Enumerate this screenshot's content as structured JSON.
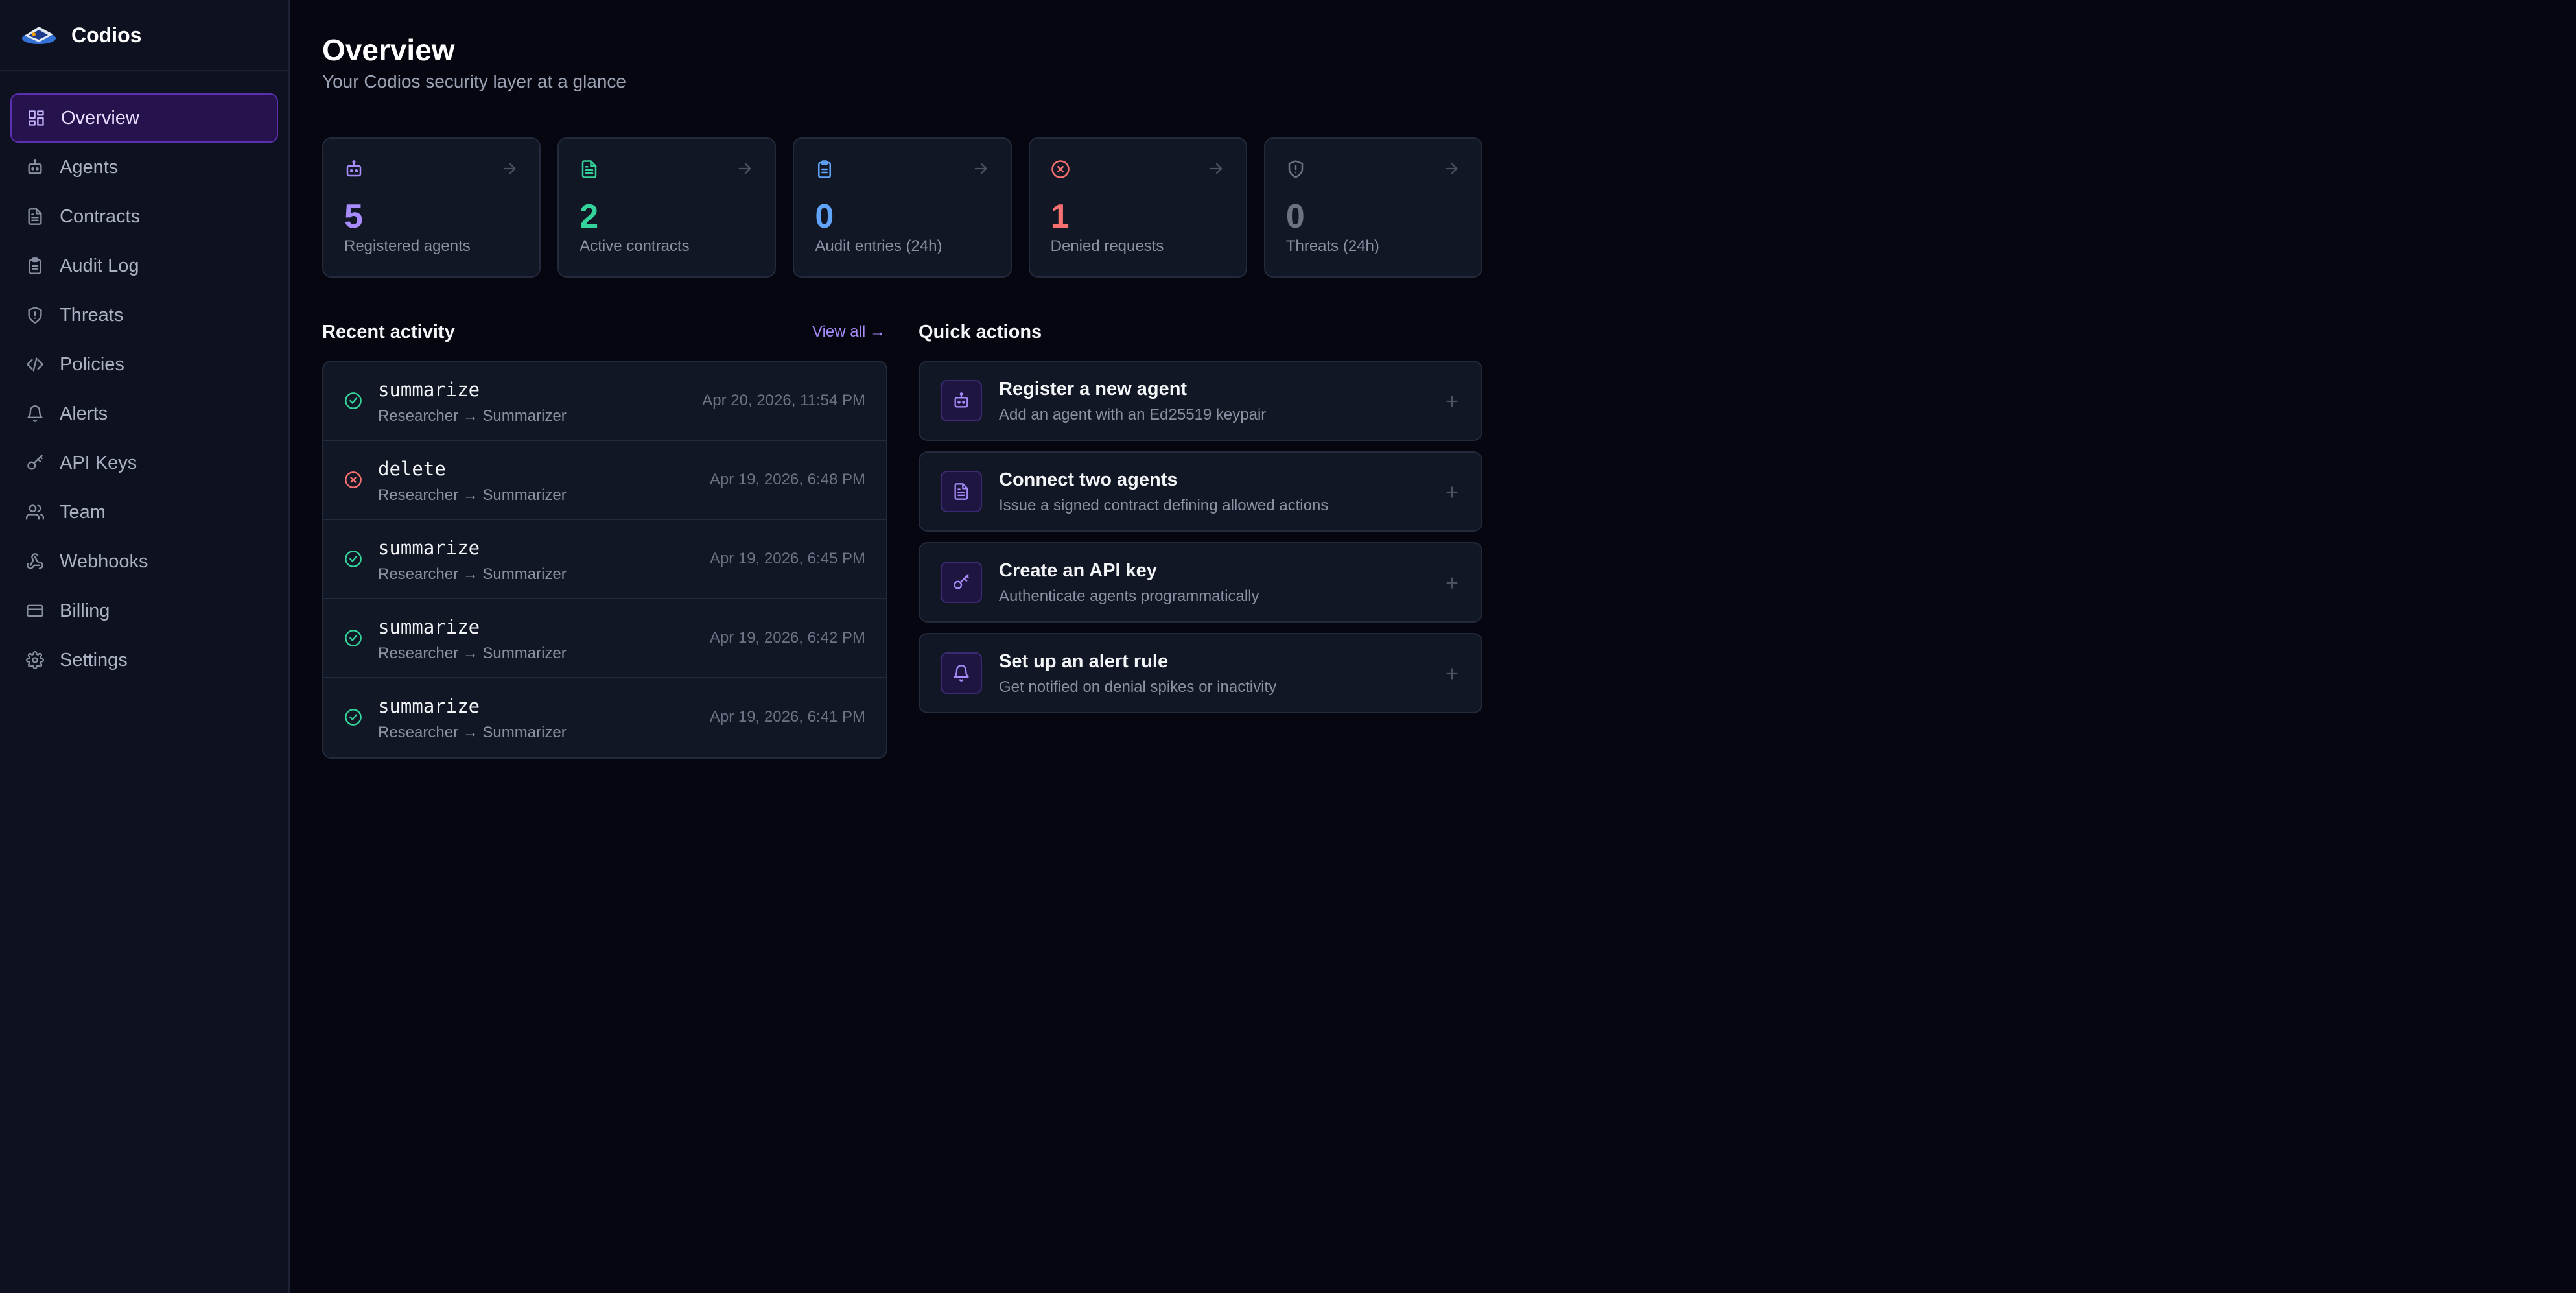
{
  "brand": {
    "name": "Codios",
    "logo": "codios-logo"
  },
  "sidebar": {
    "items": [
      {
        "label": "Overview",
        "icon": "dashboard-icon",
        "active": true
      },
      {
        "label": "Agents",
        "icon": "bot-icon"
      },
      {
        "label": "Contracts",
        "icon": "document-icon"
      },
      {
        "label": "Audit Log",
        "icon": "clipboard-icon"
      },
      {
        "label": "Threats",
        "icon": "shield-icon"
      },
      {
        "label": "Policies",
        "icon": "code-icon"
      },
      {
        "label": "Alerts",
        "icon": "bell-icon"
      },
      {
        "label": "API Keys",
        "icon": "key-icon"
      },
      {
        "label": "Team",
        "icon": "users-icon"
      },
      {
        "label": "Webhooks",
        "icon": "webhook-icon"
      },
      {
        "label": "Billing",
        "icon": "credit-card-icon"
      },
      {
        "label": "Settings",
        "icon": "gear-icon"
      }
    ]
  },
  "page": {
    "title": "Overview",
    "subtitle": "Your Codios security layer at a glance"
  },
  "stats": [
    {
      "value": "5",
      "label": "Registered agents",
      "icon": "bot-icon",
      "color": "#a78bfa"
    },
    {
      "value": "2",
      "label": "Active contracts",
      "icon": "document-icon",
      "color": "#34d399"
    },
    {
      "value": "0",
      "label": "Audit entries (24h)",
      "icon": "clipboard-icon",
      "color": "#60a5fa"
    },
    {
      "value": "1",
      "label": "Denied requests",
      "icon": "x-circle-icon",
      "color": "#f87171"
    },
    {
      "value": "0",
      "label": "Threats (24h)",
      "icon": "shield-icon",
      "color": "#6b7280"
    }
  ],
  "recent_activity": {
    "title": "Recent activity",
    "view_all": "View all →",
    "items": [
      {
        "action": "summarize",
        "route": "Researcher → Summarizer",
        "time": "Apr 20, 2026, 11:54 PM",
        "status": "allowed"
      },
      {
        "action": "delete",
        "route": "Researcher → Summarizer",
        "time": "Apr 19, 2026, 6:48 PM",
        "status": "denied"
      },
      {
        "action": "summarize",
        "route": "Researcher → Summarizer",
        "time": "Apr 19, 2026, 6:45 PM",
        "status": "allowed"
      },
      {
        "action": "summarize",
        "route": "Researcher → Summarizer",
        "time": "Apr 19, 2026, 6:42 PM",
        "status": "allowed"
      },
      {
        "action": "summarize",
        "route": "Researcher → Summarizer",
        "time": "Apr 19, 2026, 6:41 PM",
        "status": "allowed"
      }
    ]
  },
  "quick_actions": {
    "title": "Quick actions",
    "items": [
      {
        "title": "Register a new agent",
        "subtitle": "Add an agent with an Ed25519 keypair",
        "icon": "bot-icon"
      },
      {
        "title": "Connect two agents",
        "subtitle": "Issue a signed contract defining allowed actions",
        "icon": "document-icon"
      },
      {
        "title": "Create an API key",
        "subtitle": "Authenticate agents programmatically",
        "icon": "key-icon"
      },
      {
        "title": "Set up an alert rule",
        "subtitle": "Get notified on denial spikes or inactivity",
        "icon": "bell-icon"
      }
    ]
  },
  "colors": {
    "accent": "#a78bfa",
    "success": "#34d399",
    "danger": "#f87171",
    "background": "#05060f",
    "sidebar": "#0e1220"
  }
}
